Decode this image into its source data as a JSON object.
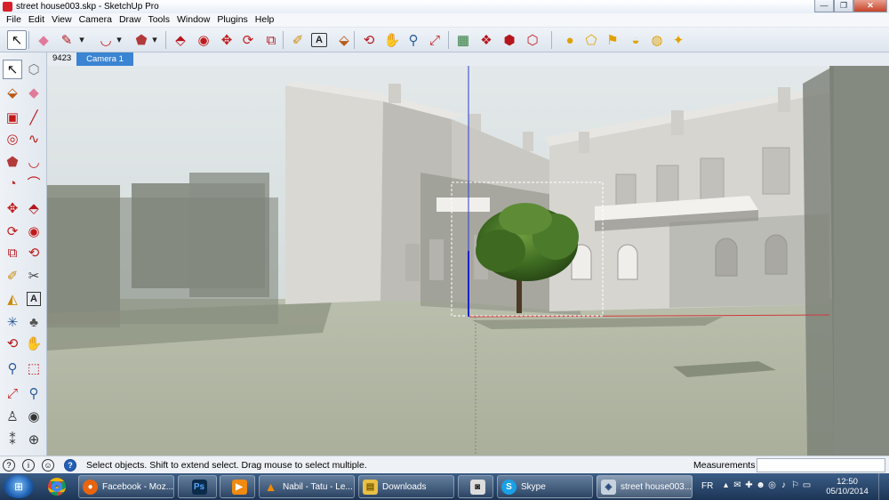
{
  "window": {
    "title": "street house003.skp - SketchUp Pro",
    "minimize": "—",
    "maximize": "❐",
    "close": "✕"
  },
  "menu": [
    "File",
    "Edit",
    "View",
    "Camera",
    "Draw",
    "Tools",
    "Window",
    "Plugins",
    "Help"
  ],
  "toolbar": {
    "buttons": [
      {
        "name": "select-icon",
        "glyph": "↖",
        "color": "#111",
        "active": true
      },
      {
        "name": "eraser-icon",
        "glyph": "◆",
        "color": "#e07a9a"
      },
      {
        "name": "pencil-icon",
        "glyph": "✎",
        "color": "#b5161c"
      },
      {
        "name": "dropdown-arrow-icon",
        "glyph": "▾",
        "color": "#222"
      },
      {
        "name": "arc-icon",
        "glyph": "◡",
        "color": "#c21a1a"
      },
      {
        "name": "dropdown-arrow-icon",
        "glyph": "▾",
        "color": "#222"
      },
      {
        "name": "polygon-icon",
        "glyph": "⬟",
        "color": "#b33a3a"
      },
      {
        "name": "dropdown-arrow-icon",
        "glyph": "▾",
        "color": "#222"
      },
      {
        "name": "push-pull-icon",
        "glyph": "⬘",
        "color": "#b5161c"
      },
      {
        "name": "follow-me-icon",
        "glyph": "◉",
        "color": "#c21a1a"
      },
      {
        "name": "move-icon",
        "glyph": "✥",
        "color": "#c21a1a"
      },
      {
        "name": "rotate-icon",
        "glyph": "⟳",
        "color": "#c21a1a"
      },
      {
        "name": "scale-icon",
        "glyph": "⧉",
        "color": "#b5161c"
      },
      {
        "name": "tape-measure-icon",
        "glyph": "✐",
        "color": "#c98b0c"
      },
      {
        "name": "text-icon",
        "glyph": "A",
        "color": "#222"
      },
      {
        "name": "paint-bucket-icon",
        "glyph": "⬙",
        "color": "#b85b17"
      },
      {
        "name": "orbit-icon",
        "glyph": "⟲",
        "color": "#b5161c"
      },
      {
        "name": "pan-icon",
        "glyph": "✋",
        "color": "#555"
      },
      {
        "name": "zoom-icon",
        "glyph": "⚲",
        "color": "#2d5a9b"
      },
      {
        "name": "zoom-extents-icon",
        "glyph": "⤢",
        "color": "#c21a1a"
      },
      {
        "name": "warehouse-icon",
        "glyph": "▦",
        "color": "#2f7a3a"
      },
      {
        "name": "components-icon",
        "glyph": "❖",
        "color": "#b5161c"
      },
      {
        "name": "extension-warehouse-icon",
        "glyph": "⬢",
        "color": "#b5161c"
      },
      {
        "name": "share-model-icon",
        "glyph": "⬡",
        "color": "#c21a1a"
      },
      {
        "name": "shadow-icon",
        "glyph": "●",
        "color": "#e0a100"
      },
      {
        "name": "geo-location-icon",
        "glyph": "⬠",
        "color": "#e0a100"
      },
      {
        "name": "sandbox-icon",
        "glyph": "⚑",
        "color": "#e0a100"
      },
      {
        "name": "terrain-icon",
        "glyph": "◒",
        "color": "#e0a100"
      },
      {
        "name": "fog-icon",
        "glyph": "◍",
        "color": "#e0a100"
      },
      {
        "name": "sun-icon",
        "glyph": "✦",
        "color": "#e0a100"
      }
    ]
  },
  "scene_tabs": {
    "frame_count": "9423",
    "active_tab": "Camera 1 (ACT)"
  },
  "palette": {
    "buttons": [
      {
        "name": "select-icon",
        "glyph": "↖",
        "color": "#111",
        "active": true
      },
      {
        "name": "make-component-icon",
        "glyph": "⬡",
        "color": "#777"
      },
      {
        "name": "paint-bucket-icon",
        "glyph": "⬙",
        "color": "#b85b17"
      },
      {
        "name": "eraser-icon",
        "glyph": "◆",
        "color": "#e07a9a"
      },
      {
        "name": "rectangle-icon",
        "glyph": "▣",
        "color": "#c21a1a"
      },
      {
        "name": "line-icon",
        "glyph": "╱",
        "color": "#b5161c"
      },
      {
        "name": "circle-icon",
        "glyph": "◎",
        "color": "#c21a1a"
      },
      {
        "name": "freehand-icon",
        "glyph": "∿",
        "color": "#c21a1a"
      },
      {
        "name": "polygon-icon",
        "glyph": "⬟",
        "color": "#b33a3a"
      },
      {
        "name": "arc-icon",
        "glyph": "◡",
        "color": "#c21a1a"
      },
      {
        "name": "pie-icon",
        "glyph": "◔",
        "color": "#c21a1a"
      },
      {
        "name": "two-point-arc-icon",
        "glyph": "⌒",
        "color": "#c21a1a"
      },
      {
        "name": "move-icon",
        "glyph": "✥",
        "color": "#c21a1a"
      },
      {
        "name": "push-pull-icon",
        "glyph": "⬘",
        "color": "#b5161c"
      },
      {
        "name": "rotate-icon",
        "glyph": "⟳",
        "color": "#c21a1a"
      },
      {
        "name": "follow-me-icon",
        "glyph": "◉",
        "color": "#c21a1a"
      },
      {
        "name": "scale-icon",
        "glyph": "⧉",
        "color": "#b5161c"
      },
      {
        "name": "offset-icon",
        "glyph": "⟲",
        "color": "#c21a1a"
      },
      {
        "name": "tape-measure-icon",
        "glyph": "✐",
        "color": "#c98b0c"
      },
      {
        "name": "dimension-icon",
        "glyph": "✂",
        "color": "#444"
      },
      {
        "name": "protractor-icon",
        "glyph": "◭",
        "color": "#c98b0c"
      },
      {
        "name": "text-icon",
        "glyph": "A",
        "color": "#222"
      },
      {
        "name": "axes-icon",
        "glyph": "✳",
        "color": "#2d5a9b"
      },
      {
        "name": "3d-text-icon",
        "glyph": "♣",
        "color": "#555"
      },
      {
        "name": "orbit-icon",
        "glyph": "⟲",
        "color": "#b5161c"
      },
      {
        "name": "pan-icon",
        "glyph": "✋",
        "color": "#555"
      },
      {
        "name": "zoom-icon",
        "glyph": "⚲",
        "color": "#2d5a9b"
      },
      {
        "name": "zoom-window-icon",
        "glyph": "⬚",
        "color": "#c21a1a"
      },
      {
        "name": "zoom-extents-icon",
        "glyph": "⤢",
        "color": "#c21a1a"
      },
      {
        "name": "previous-view-icon",
        "glyph": "⚲",
        "color": "#2d5a9b"
      },
      {
        "name": "position-camera-icon",
        "glyph": "♙",
        "color": "#333"
      },
      {
        "name": "look-around-icon",
        "glyph": "◉",
        "color": "#333"
      },
      {
        "name": "walk-icon",
        "glyph": "⁑",
        "color": "#333"
      },
      {
        "name": "section-plane-icon",
        "glyph": "⊕",
        "color": "#333"
      }
    ]
  },
  "statusbar": {
    "message": "Select objects. Shift to extend select. Drag mouse to select multiple.",
    "measurements_label": "Measurements",
    "measurements_value": ""
  },
  "taskbar": {
    "items": [
      {
        "name": "firefox",
        "label": "Facebook - Moz...",
        "icon": "●",
        "icon_bg": "#e8650e"
      },
      {
        "name": "photoshop",
        "label": "",
        "icon": "Ps",
        "icon_bg": "#0c2b4a"
      },
      {
        "name": "media-player",
        "label": "",
        "icon": "▶",
        "icon_bg": "#f08a10"
      },
      {
        "name": "vlc",
        "label": "Nabil - Tatu - Le...",
        "icon": "▲",
        "icon_bg": "#f38b00"
      },
      {
        "name": "explorer",
        "label": "Downloads",
        "icon": "▤",
        "icon_bg": "#e9c044"
      },
      {
        "name": "camera",
        "label": "",
        "icon": "◙",
        "icon_bg": "#ddd"
      },
      {
        "name": "skype",
        "label": "Skype",
        "icon": "S",
        "icon_bg": "#1aa0e6"
      },
      {
        "name": "sketchup",
        "label": "street house003....",
        "icon": "◈",
        "icon_bg": "#c8d2de"
      }
    ],
    "language": "FR",
    "tray": [
      "▴",
      "✉",
      "✚",
      "☻",
      "◎",
      "♪",
      "⚐",
      "▭"
    ],
    "time": "12:50",
    "date": "05/10/2014"
  }
}
